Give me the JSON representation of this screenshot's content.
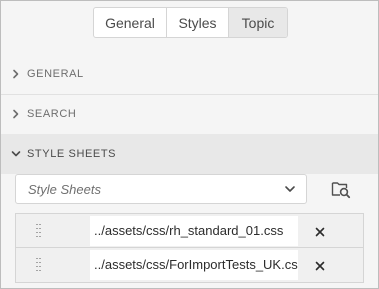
{
  "tabs": [
    {
      "label": "General"
    },
    {
      "label": "Styles"
    },
    {
      "label": "Topic",
      "selected": true
    }
  ],
  "sections": {
    "general": {
      "label": "GENERAL",
      "expanded": false
    },
    "search": {
      "label": "SEARCH",
      "expanded": false
    },
    "style_sheets": {
      "label": "STYLE SHEETS",
      "expanded": true
    }
  },
  "style_sheets": {
    "select_placeholder": "Style Sheets",
    "browse_icon": "folder-search-icon",
    "items": [
      {
        "path": "../assets/css/rh_standard_01.css"
      },
      {
        "path": "../assets/css/ForImportTests_UK.css"
      }
    ]
  },
  "colors": {
    "panel_bg": "#f5f5f5",
    "selected_bg": "#e8e8e8",
    "border": "#d5d5d5",
    "text": "#4b4b4b"
  }
}
